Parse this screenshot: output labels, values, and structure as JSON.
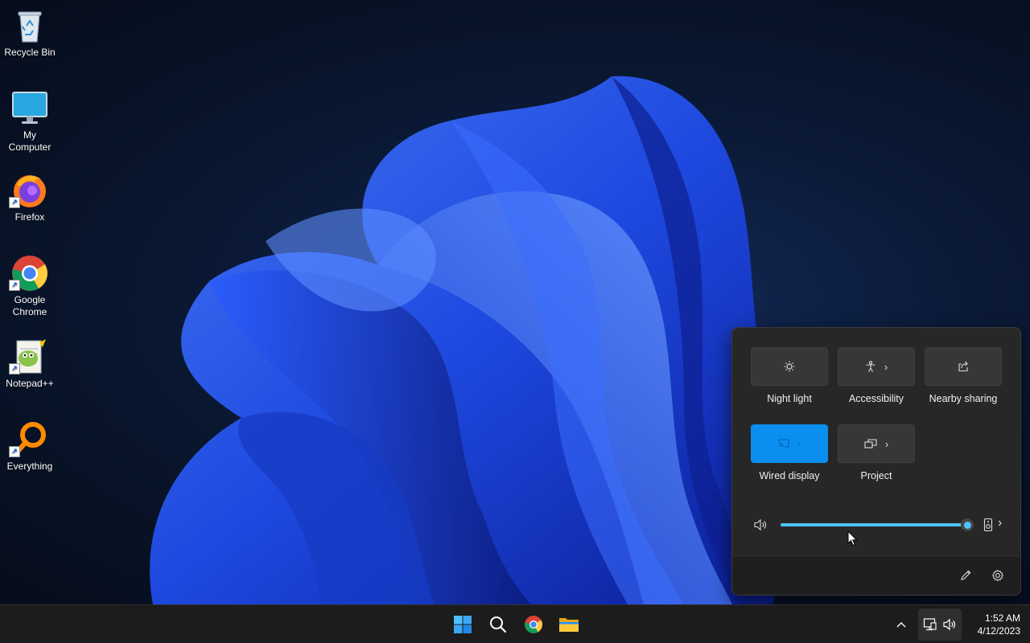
{
  "desktop": {
    "icons": [
      {
        "label": "Recycle Bin"
      },
      {
        "label": "My Computer"
      },
      {
        "label": "Firefox"
      },
      {
        "label": "Google Chrome"
      },
      {
        "label": "Notepad++"
      },
      {
        "label": "Everything"
      }
    ]
  },
  "quick_settings": {
    "tiles": [
      {
        "label": "Night light",
        "icon": "night-light-icon",
        "active": false
      },
      {
        "label": "Accessibility",
        "icon": "accessibility-icon",
        "active": false,
        "has_chevron": true
      },
      {
        "label": "Nearby sharing",
        "icon": "nearby-sharing-icon",
        "active": false
      },
      {
        "label": "Wired display",
        "icon": "cast-icon",
        "active": true
      },
      {
        "label": "Project",
        "icon": "project-icon",
        "active": false,
        "has_chevron": true
      }
    ],
    "volume": {
      "level": 1.0
    },
    "footer": {
      "edit_icon": "pencil-icon",
      "settings_icon": "gear-icon"
    }
  },
  "taskbar": {
    "pinned": [
      "start-icon",
      "search-icon",
      "chrome-icon",
      "file-explorer-icon"
    ],
    "clock": {
      "time": "1:52 AM",
      "date": "4/12/2023"
    }
  },
  "colors": {
    "accent": "#0a8ff0",
    "slider": "#4cc2ff",
    "flyout_bg": "#272727",
    "taskbar_bg": "#1c1c1c"
  }
}
